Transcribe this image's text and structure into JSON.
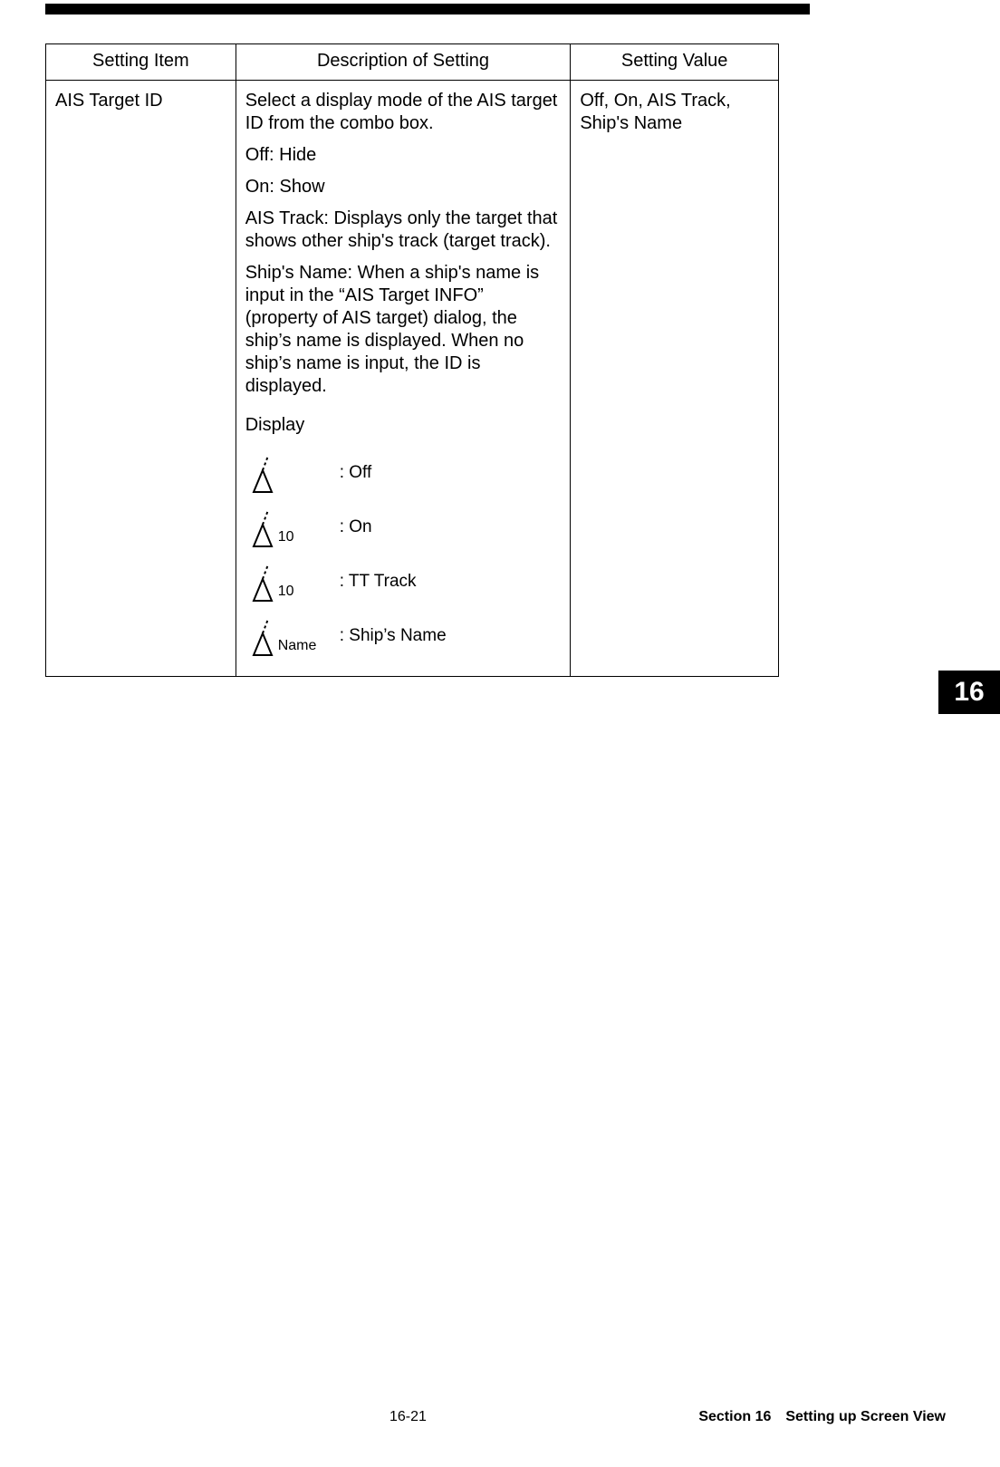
{
  "table": {
    "headers": {
      "item": "Setting Item",
      "desc": "Description of Setting",
      "value": "Setting Value"
    },
    "rows": [
      {
        "item": "AIS Target ID",
        "desc_paragraphs": [
          "Select a display mode of the AIS target ID from the combo box.",
          "Off: Hide",
          "On: Show",
          "AIS Track: Displays only the target that shows other ship's track (target track).",
          "Ship's Name: When a ship's name is input in the “AIS Target INFO” (property of AIS target) dialog, the ship’s name is displayed. When no ship’s name is input, the ID is displayed."
        ],
        "display_header": "Display",
        "display_items": [
          {
            "sub": "",
            "label": ": Off"
          },
          {
            "sub": "10",
            "label": ": On"
          },
          {
            "sub": "10",
            "label": ": TT Track"
          },
          {
            "sub": "Name",
            "label": ": Ship’s Name"
          }
        ],
        "value": "Off, On, AIS Track, Ship's Name"
      }
    ]
  },
  "page_tab": "16",
  "footer": {
    "page_num": "16-21",
    "section": "Section 16 Setting up Screen View"
  }
}
